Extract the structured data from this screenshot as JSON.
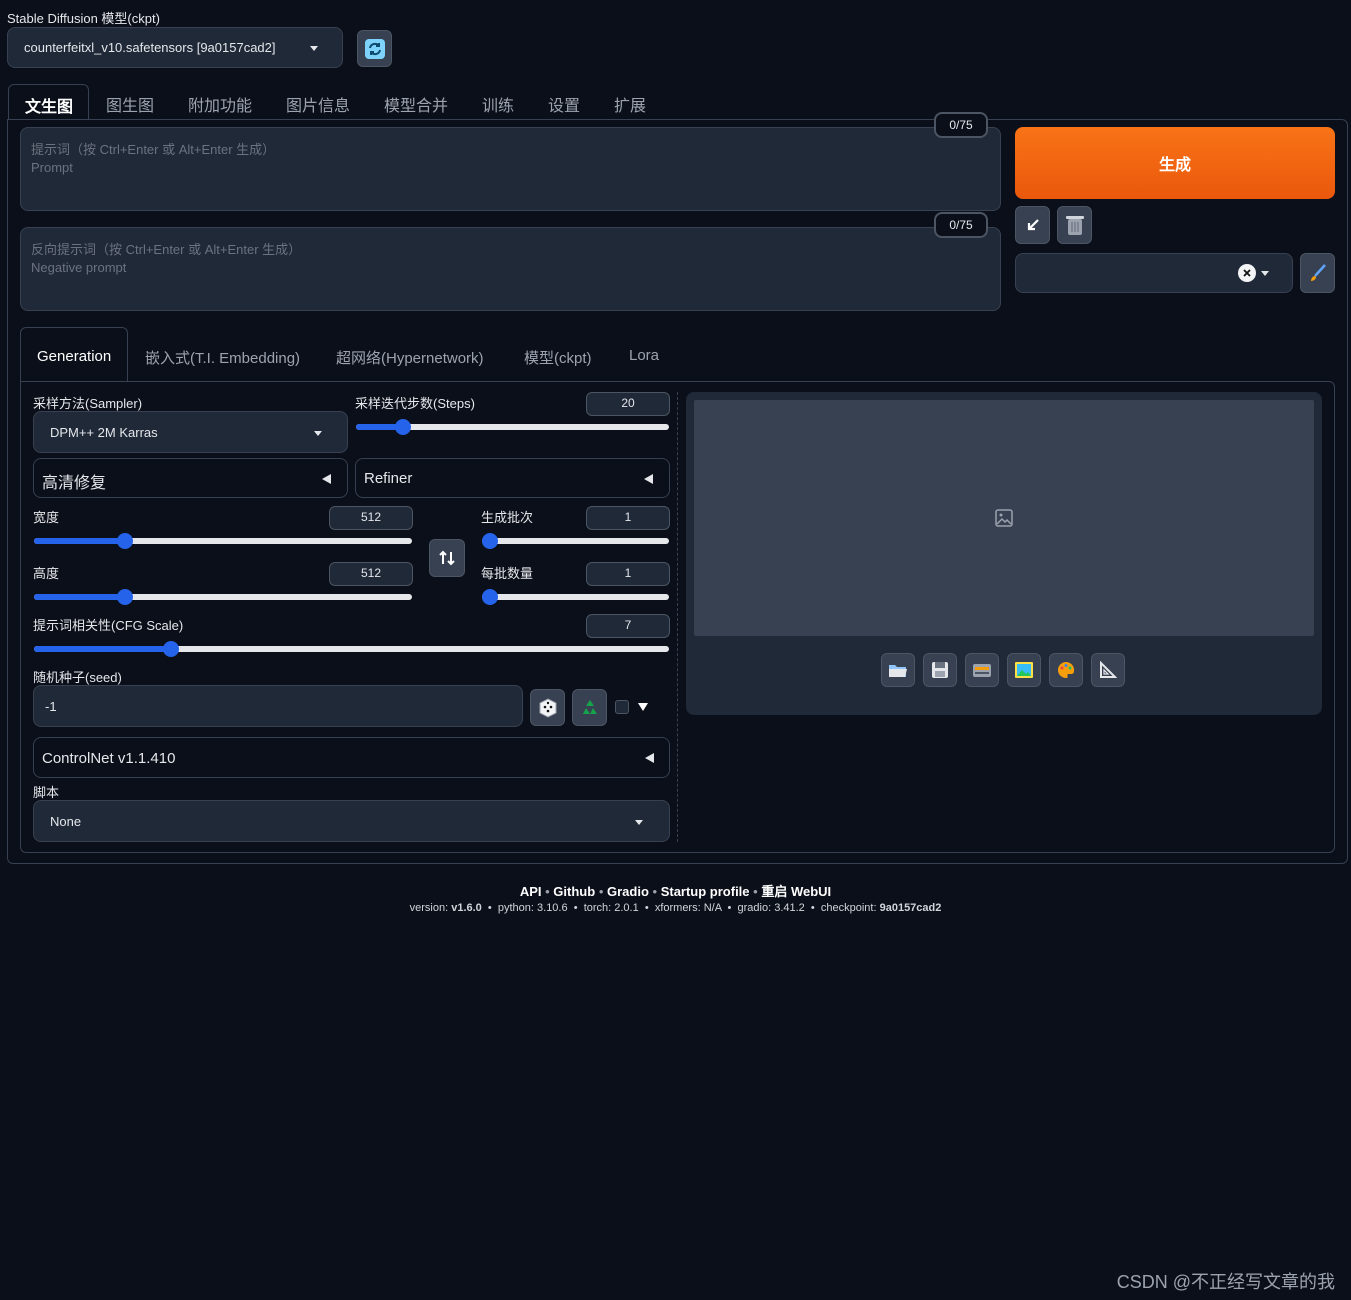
{
  "model": {
    "label": "Stable Diffusion 模型(ckpt)",
    "selected": "counterfeitxl_v10.safetensors [9a0157cad2]"
  },
  "tabs": [
    "文生图",
    "图生图",
    "附加功能",
    "图片信息",
    "模型合并",
    "训练",
    "设置",
    "扩展"
  ],
  "prompt": {
    "counter": "0/75",
    "placeholder_line1": "提示词（按 Ctrl+Enter 或 Alt+Enter 生成）",
    "placeholder_line2": "Prompt"
  },
  "negative_prompt": {
    "counter": "0/75",
    "placeholder_line1": "反向提示词（按 Ctrl+Enter 或 Alt+Enter 生成）",
    "placeholder_line2": "Negative prompt"
  },
  "generate_label": "生成",
  "sub_tabs": [
    "Generation",
    "嵌入式(T.I. Embedding)",
    "超网络(Hypernetwork)",
    "模型(ckpt)",
    "Lora"
  ],
  "sampler": {
    "label": "采样方法(Sampler)",
    "value": "DPM++ 2M Karras"
  },
  "steps": {
    "label": "采样迭代步数(Steps)",
    "value": "20",
    "fraction": 0.15
  },
  "hires_label": "高清修复",
  "refiner_label": "Refiner",
  "width": {
    "label": "宽度",
    "value": "512",
    "fraction": 0.24
  },
  "height": {
    "label": "高度",
    "value": "512",
    "fraction": 0.24
  },
  "batch_count": {
    "label": "生成批次",
    "value": "1",
    "fraction": 0.0
  },
  "batch_size": {
    "label": "每批数量",
    "value": "1",
    "fraction": 0.0
  },
  "cfg": {
    "label": "提示词相关性(CFG Scale)",
    "value": "7",
    "fraction": 0.215
  },
  "seed": {
    "label": "随机种子(seed)",
    "value": "-1"
  },
  "controlnet_label": "ControlNet v1.1.410",
  "script": {
    "label": "脚本",
    "value": "None"
  },
  "footer": {
    "links": [
      "API",
      "Github",
      "Gradio",
      "Startup profile",
      "重启 WebUI"
    ],
    "version_label": "version:",
    "version": "v1.6.0",
    "python": "python: 3.10.6",
    "torch": "torch: 2.0.1",
    "xformers": "xformers: N/A",
    "gradio": "gradio: 3.41.2",
    "checkpoint_label": "checkpoint:",
    "checkpoint": "9a0157cad2"
  },
  "watermark": "CSDN @不正经写文章的我",
  "colors": {
    "accent": "#2563eb",
    "generate": "#ea580c",
    "background": "#0b0f19",
    "panel": "#1f2937"
  },
  "icons": [
    "refresh-icon",
    "arrow-down-left-icon",
    "trash-icon",
    "close-icon",
    "brush-icon",
    "swap-icon",
    "dice-icon",
    "recycle-icon",
    "image-placeholder-icon",
    "folder-icon",
    "save-icon",
    "zip-icon",
    "image-icon",
    "palette-icon",
    "ruler-icon"
  ]
}
